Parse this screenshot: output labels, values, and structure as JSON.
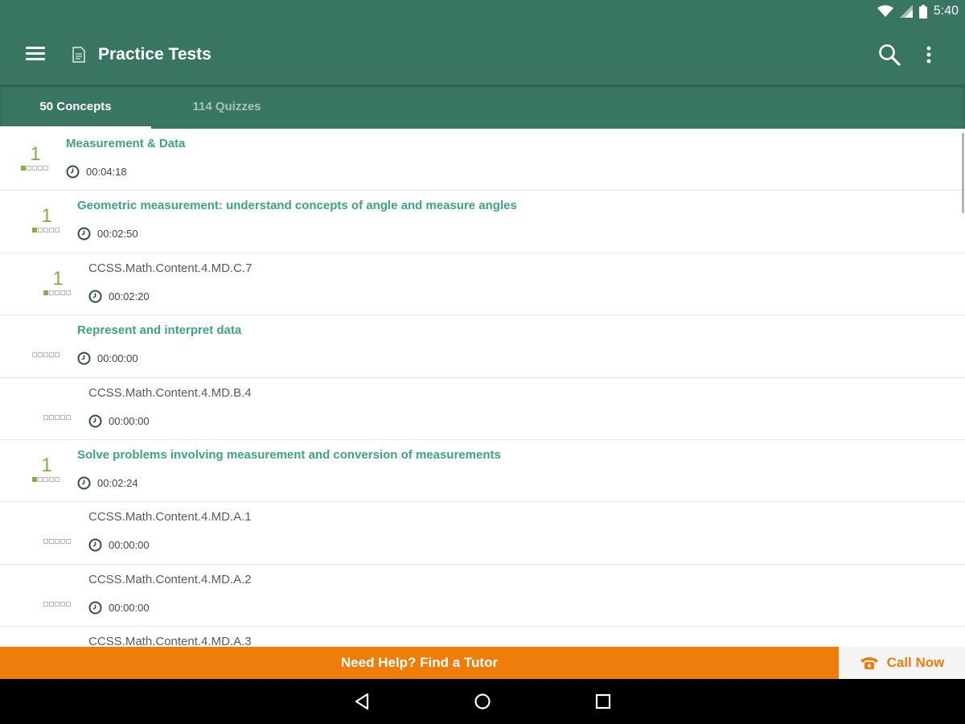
{
  "status_bar": {
    "time": "5:40"
  },
  "app_bar": {
    "title": "Practice Tests"
  },
  "tabs": [
    {
      "label": "50 Concepts",
      "selected": true
    },
    {
      "label": "114 Quizzes",
      "selected": false
    }
  ],
  "rows": [
    {
      "title": "Measurement & Data",
      "type": "heading",
      "level": 0,
      "score": "1",
      "progress": "1 of 5",
      "time": "00:04:18"
    },
    {
      "title": "Geometric measurement: understand concepts of angle and measure angles",
      "type": "heading",
      "level": 1,
      "score": "1",
      "progress": "1 of 5",
      "time": "00:02:50"
    },
    {
      "title": "CCSS.Math.Content.4.MD.C.7",
      "type": "standard",
      "level": 2,
      "score": "1",
      "progress": "1 of 5",
      "time": "00:02:20"
    },
    {
      "title": "Represent and interpret data",
      "type": "heading",
      "level": 1,
      "score": "",
      "progress": "0 of 5",
      "time": "00:00:00"
    },
    {
      "title": "CCSS.Math.Content.4.MD.B.4",
      "type": "standard",
      "level": 2,
      "score": "",
      "progress": "0 of 5",
      "time": "00:00:00"
    },
    {
      "title": "Solve problems involving measurement and conversion of measurements",
      "type": "heading",
      "level": 1,
      "score": "1",
      "progress": "1 of 5",
      "time": "00:02:24"
    },
    {
      "title": "CCSS.Math.Content.4.MD.A.1",
      "type": "standard",
      "level": 2,
      "score": "",
      "progress": "0 of 5",
      "time": "00:00:00"
    },
    {
      "title": "CCSS.Math.Content.4.MD.A.2",
      "type": "standard",
      "level": 2,
      "score": "",
      "progress": "0 of 5",
      "time": "00:00:00"
    },
    {
      "title": "CCSS.Math.Content.4.MD.A.3",
      "type": "standard",
      "level": 2,
      "score": "",
      "progress": "0 of 5",
      "time": ""
    }
  ],
  "banner": {
    "label": "Need Help? Find a Tutor"
  },
  "call": {
    "label": "Call Now"
  },
  "colors": {
    "primary": "#387562",
    "heading_text": "#3aa580",
    "score_green": "#7cb342",
    "banner_orange": "#ef7d0a"
  },
  "icons": [
    "wifi-icon",
    "signal-icon",
    "battery-icon",
    "menu-icon",
    "document-icon",
    "search-icon",
    "overflow-menu-icon",
    "clock-icon",
    "phone-icon",
    "back-icon",
    "home-icon",
    "recents-icon"
  ]
}
